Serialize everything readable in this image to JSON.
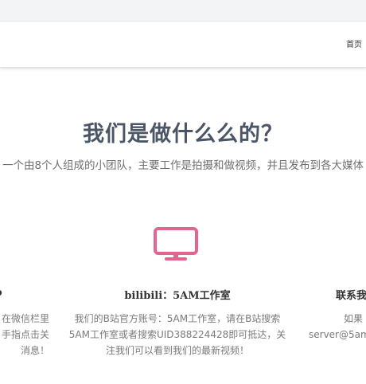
{
  "nav": {
    "home": "首页"
  },
  "about": {
    "title": "我们是做什么么的？",
    "description": "一个由8个人组成的小团队，主要工作是拍摄和做视频，并且发布到各大媒体"
  },
  "columns": {
    "left": {
      "title": "o",
      "lines": [
        "在微信栏里",
        "手指点击关",
        "消息！"
      ]
    },
    "middle": {
      "icon": "tv-icon",
      "title": "bilibili：5AM工作室",
      "lines": [
        "我们的B站官方账号：5AM工作室，请在B站搜索",
        "5AM工作室或者搜索UID388224428即可抵达，关",
        "注我们可以看到我们的最新视频！"
      ]
    },
    "right": {
      "title": "联系我",
      "lines": [
        "如果",
        "server@5am"
      ]
    }
  },
  "colors": {
    "accent": "#e0658f",
    "heading": "#4a5566"
  }
}
